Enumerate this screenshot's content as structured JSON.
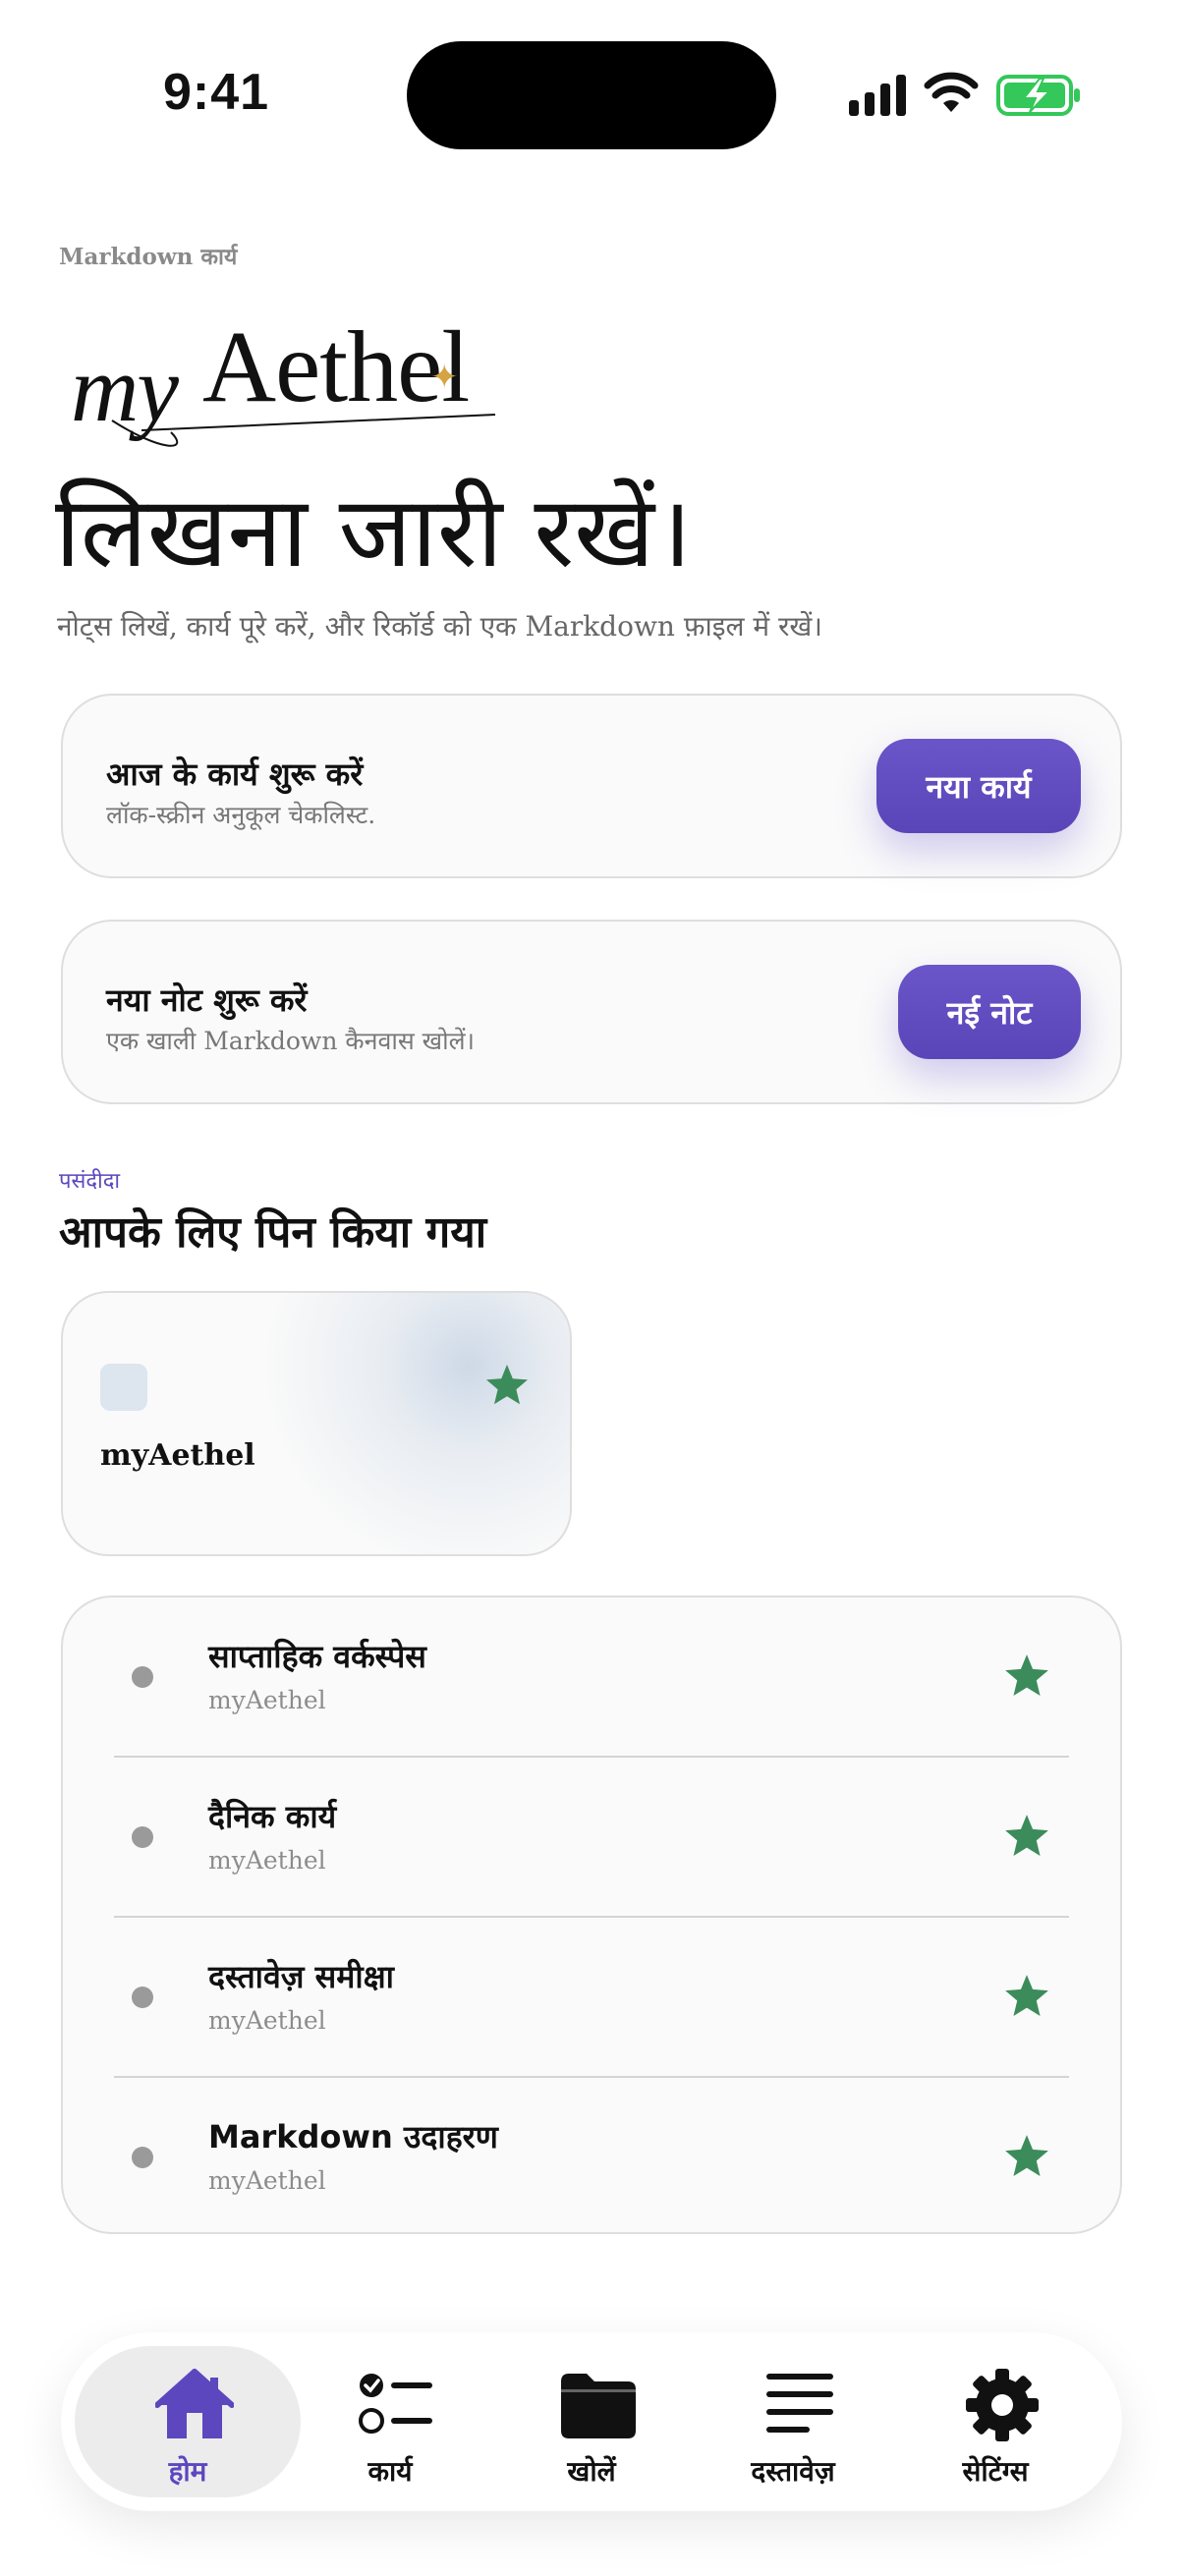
{
  "status_bar": {
    "time": "9:41"
  },
  "header": {
    "eyebrow": "Markdown कार्य",
    "logo_my": "my",
    "logo_aethel": "Aethel",
    "title": "लिखना जारी रखें।",
    "subtitle": "नोट्स लिखें, कार्य पूरे करें, और रिकॉर्ड को एक Markdown फ़ाइल में रखें।"
  },
  "cards": [
    {
      "title": "आज के कार्य शुरू करें",
      "desc": "लॉक-स्क्रीन अनुकूल चेकलिस्ट.",
      "button": "नया कार्य"
    },
    {
      "title": "नया नोट शुरू करें",
      "desc": "एक खाली Markdown कैनवास खोलें।",
      "button": "नई नोट"
    }
  ],
  "favorites": {
    "eyebrow": "पसंदीदा",
    "title": "आपके लिए पिन किया गया",
    "pinned_card": {
      "name": "myAethel",
      "starred": true
    },
    "items": [
      {
        "title": "साप्ताहिक वर्कस्पेस",
        "subtitle": "myAethel",
        "starred": true
      },
      {
        "title": "दैनिक कार्य",
        "subtitle": "myAethel",
        "starred": true
      },
      {
        "title": "दस्तावेज़ समीक्षा",
        "subtitle": "myAethel",
        "starred": true
      },
      {
        "title": "Markdown उदाहरण",
        "subtitle": "myAethel",
        "starred": true
      }
    ]
  },
  "tabbar": {
    "tabs": [
      {
        "label": "होम",
        "icon": "home-icon",
        "active": true
      },
      {
        "label": "कार्य",
        "icon": "checklist-icon",
        "active": false
      },
      {
        "label": "खोलें",
        "icon": "folder-icon",
        "active": false
      },
      {
        "label": "दस्तावेज़",
        "icon": "document-lines-icon",
        "active": false
      },
      {
        "label": "सेटिंग्स",
        "icon": "gear-icon",
        "active": false
      }
    ]
  },
  "colors": {
    "accent": "#5c47bf",
    "star": "#3b8c5a",
    "logo_spark": "#d4a443"
  }
}
